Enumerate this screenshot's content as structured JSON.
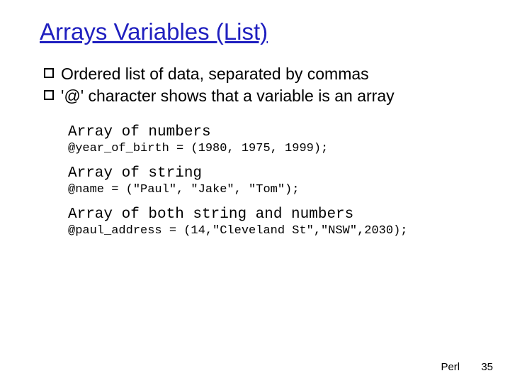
{
  "title": "Arrays Variables (List)",
  "bullets": [
    "Ordered list of data, separated by commas",
    "'@' character shows that a variable is an array"
  ],
  "examples": [
    {
      "label": "Array of numbers",
      "code": "@year_of_birth = (1980, 1975, 1999);"
    },
    {
      "label": "Array of string",
      "code": "@name = (\"Paul\", \"Jake\", \"Tom\");"
    },
    {
      "label": "Array of both string and numbers",
      "code": "@paul_address = (14,\"Cleveland St\",\"NSW\",2030);"
    }
  ],
  "footer": {
    "text": "Perl",
    "page": "35"
  }
}
